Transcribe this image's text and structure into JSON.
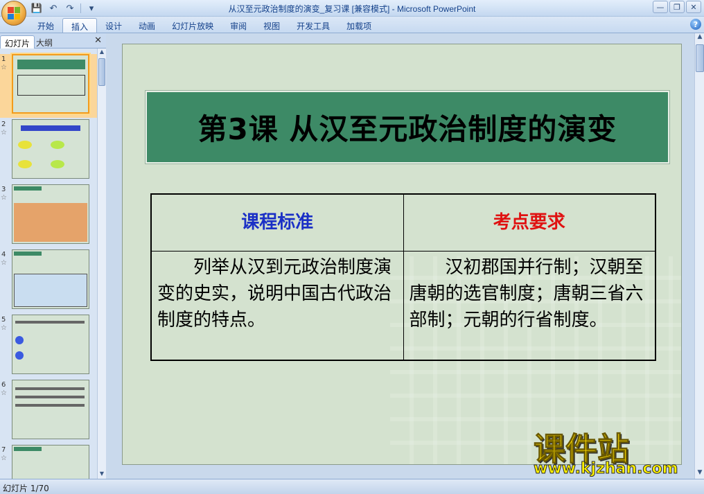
{
  "window": {
    "title": "从汉至元政治制度的演变_复习课 [兼容模式] - Microsoft PowerPoint",
    "controls": [
      "—",
      "❐",
      "✕"
    ]
  },
  "qat": {
    "save": "💾",
    "undo": "↶",
    "redo": "↷",
    "more": "▾"
  },
  "ribbon": {
    "tabs": [
      "开始",
      "插入",
      "设计",
      "动画",
      "幻灯片放映",
      "审阅",
      "视图",
      "开发工具",
      "加载项"
    ],
    "active_tab": "插入"
  },
  "left_panel": {
    "tab_slides": "幻灯片",
    "tab_outline": "大纲",
    "close": "✕",
    "thumbnails": [
      {
        "num": "1",
        "selected": true
      },
      {
        "num": "2",
        "selected": false
      },
      {
        "num": "3",
        "selected": false
      },
      {
        "num": "4",
        "selected": false
      },
      {
        "num": "5",
        "selected": false
      },
      {
        "num": "6",
        "selected": false
      },
      {
        "num": "7",
        "selected": false
      }
    ]
  },
  "slide": {
    "title": "第3课  从汉至元政治制度的演变",
    "table": {
      "header_left": "课程标准",
      "header_right": "考点要求",
      "cell_left": "列举从汉到元政治制度演变的史实，说明中国古代政治制度的特点。",
      "cell_right": "汉初郡国并行制；汉朝至唐朝的选官制度；唐朝三省六部制；元朝的行省制度。"
    }
  },
  "watermark": {
    "text": "课件站",
    "url": "www.kjzhan.com"
  },
  "status": {
    "text": "幻灯片 1/70"
  },
  "colors": {
    "title_bg": "#3d8a66",
    "header_left": "#1b30c6",
    "header_right": "#e01111",
    "slide_bg": "#d4e2cf"
  }
}
